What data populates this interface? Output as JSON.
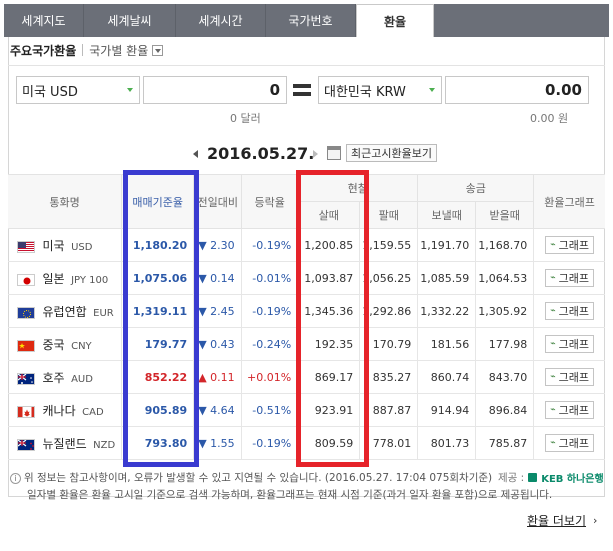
{
  "tabs": [
    {
      "label": "세계지도"
    },
    {
      "label": "세계날씨"
    },
    {
      "label": "세계시간"
    },
    {
      "label": "국가번호"
    },
    {
      "label": "환율"
    }
  ],
  "subheader": {
    "title": "주요국가환율",
    "subtitle": "국가별 환율"
  },
  "converter": {
    "from_currency": "미국 USD",
    "from_amount": "0",
    "to_currency": "대한민국 KRW",
    "to_amount": "0.00",
    "from_hint": "0 달러",
    "to_hint": "0.00 원"
  },
  "date": "2016.05.27.",
  "recent_button": "최근고시환율보기",
  "table": {
    "headers": {
      "currency": "통화명",
      "base_rate": "매매기준율",
      "vs_prev": "전일대비",
      "change_rate": "등락율",
      "cash_group": "현찰",
      "cash_buy": "살때",
      "cash_sell": "팔때",
      "wire_group": "송금",
      "wire_send": "보낼때",
      "wire_receive": "받을때",
      "graph": "환율그래프"
    },
    "rows": [
      {
        "flag": "us",
        "name": "미국",
        "code": "USD",
        "rate": "1,180.20",
        "dir": "down",
        "change": "2.30",
        "pct": "-0.19%",
        "buy": "1,200.85",
        "sell": "1,159.55",
        "send": "1,191.70",
        "receive": "1,168.70",
        "graph": "그래프"
      },
      {
        "flag": "jp",
        "name": "일본",
        "code": "JPY 100",
        "rate": "1,075.06",
        "dir": "down",
        "change": "0.14",
        "pct": "-0.01%",
        "buy": "1,093.87",
        "sell": "1,056.25",
        "send": "1,085.59",
        "receive": "1,064.53",
        "graph": "그래프"
      },
      {
        "flag": "eu",
        "name": "유럽연합",
        "code": "EUR",
        "rate": "1,319.11",
        "dir": "down",
        "change": "2.45",
        "pct": "-0.19%",
        "buy": "1,345.36",
        "sell": "1,292.86",
        "send": "1,332.22",
        "receive": "1,305.92",
        "graph": "그래프"
      },
      {
        "flag": "cn",
        "name": "중국",
        "code": "CNY",
        "rate": "179.77",
        "dir": "down",
        "change": "0.43",
        "pct": "-0.24%",
        "buy": "192.35",
        "sell": "170.79",
        "send": "181.56",
        "receive": "177.98",
        "graph": "그래프"
      },
      {
        "flag": "au",
        "name": "호주",
        "code": "AUD",
        "rate": "852.22",
        "dir": "up",
        "change": "0.11",
        "pct": "+0.01%",
        "buy": "869.17",
        "sell": "835.27",
        "send": "860.74",
        "receive": "843.70",
        "graph": "그래프"
      },
      {
        "flag": "ca",
        "name": "캐나다",
        "code": "CAD",
        "rate": "905.89",
        "dir": "down",
        "change": "4.64",
        "pct": "-0.51%",
        "buy": "923.91",
        "sell": "887.87",
        "send": "914.94",
        "receive": "896.84",
        "graph": "그래프"
      },
      {
        "flag": "nz",
        "name": "뉴질랜드",
        "code": "NZD",
        "rate": "793.80",
        "dir": "down",
        "change": "1.55",
        "pct": "-0.19%",
        "buy": "809.59",
        "sell": "778.01",
        "send": "801.73",
        "receive": "785.87",
        "graph": "그래프"
      }
    ]
  },
  "footer": {
    "line1": "위 정보는 참고사항이며, 오류가 발생할 수 있고 지연될 수 있습니다. (2016.05.27. 17:04 075회차기준)",
    "provider_label": "제공 :",
    "provider_name": "KEB 하나은행",
    "line2": "일자별 환율은 환율 고시일 기준으로 검색 가능하며, 환율그래프는 현재 시점 기준(과거 일자 환율 포함)으로 제공됩니다.",
    "more_link": "환율 더보기"
  },
  "colors": {
    "accent_blue": "#2b58a8",
    "accent_red": "#d3262a",
    "box_blue": "#3a3bd0",
    "box_red": "#e6232a"
  }
}
